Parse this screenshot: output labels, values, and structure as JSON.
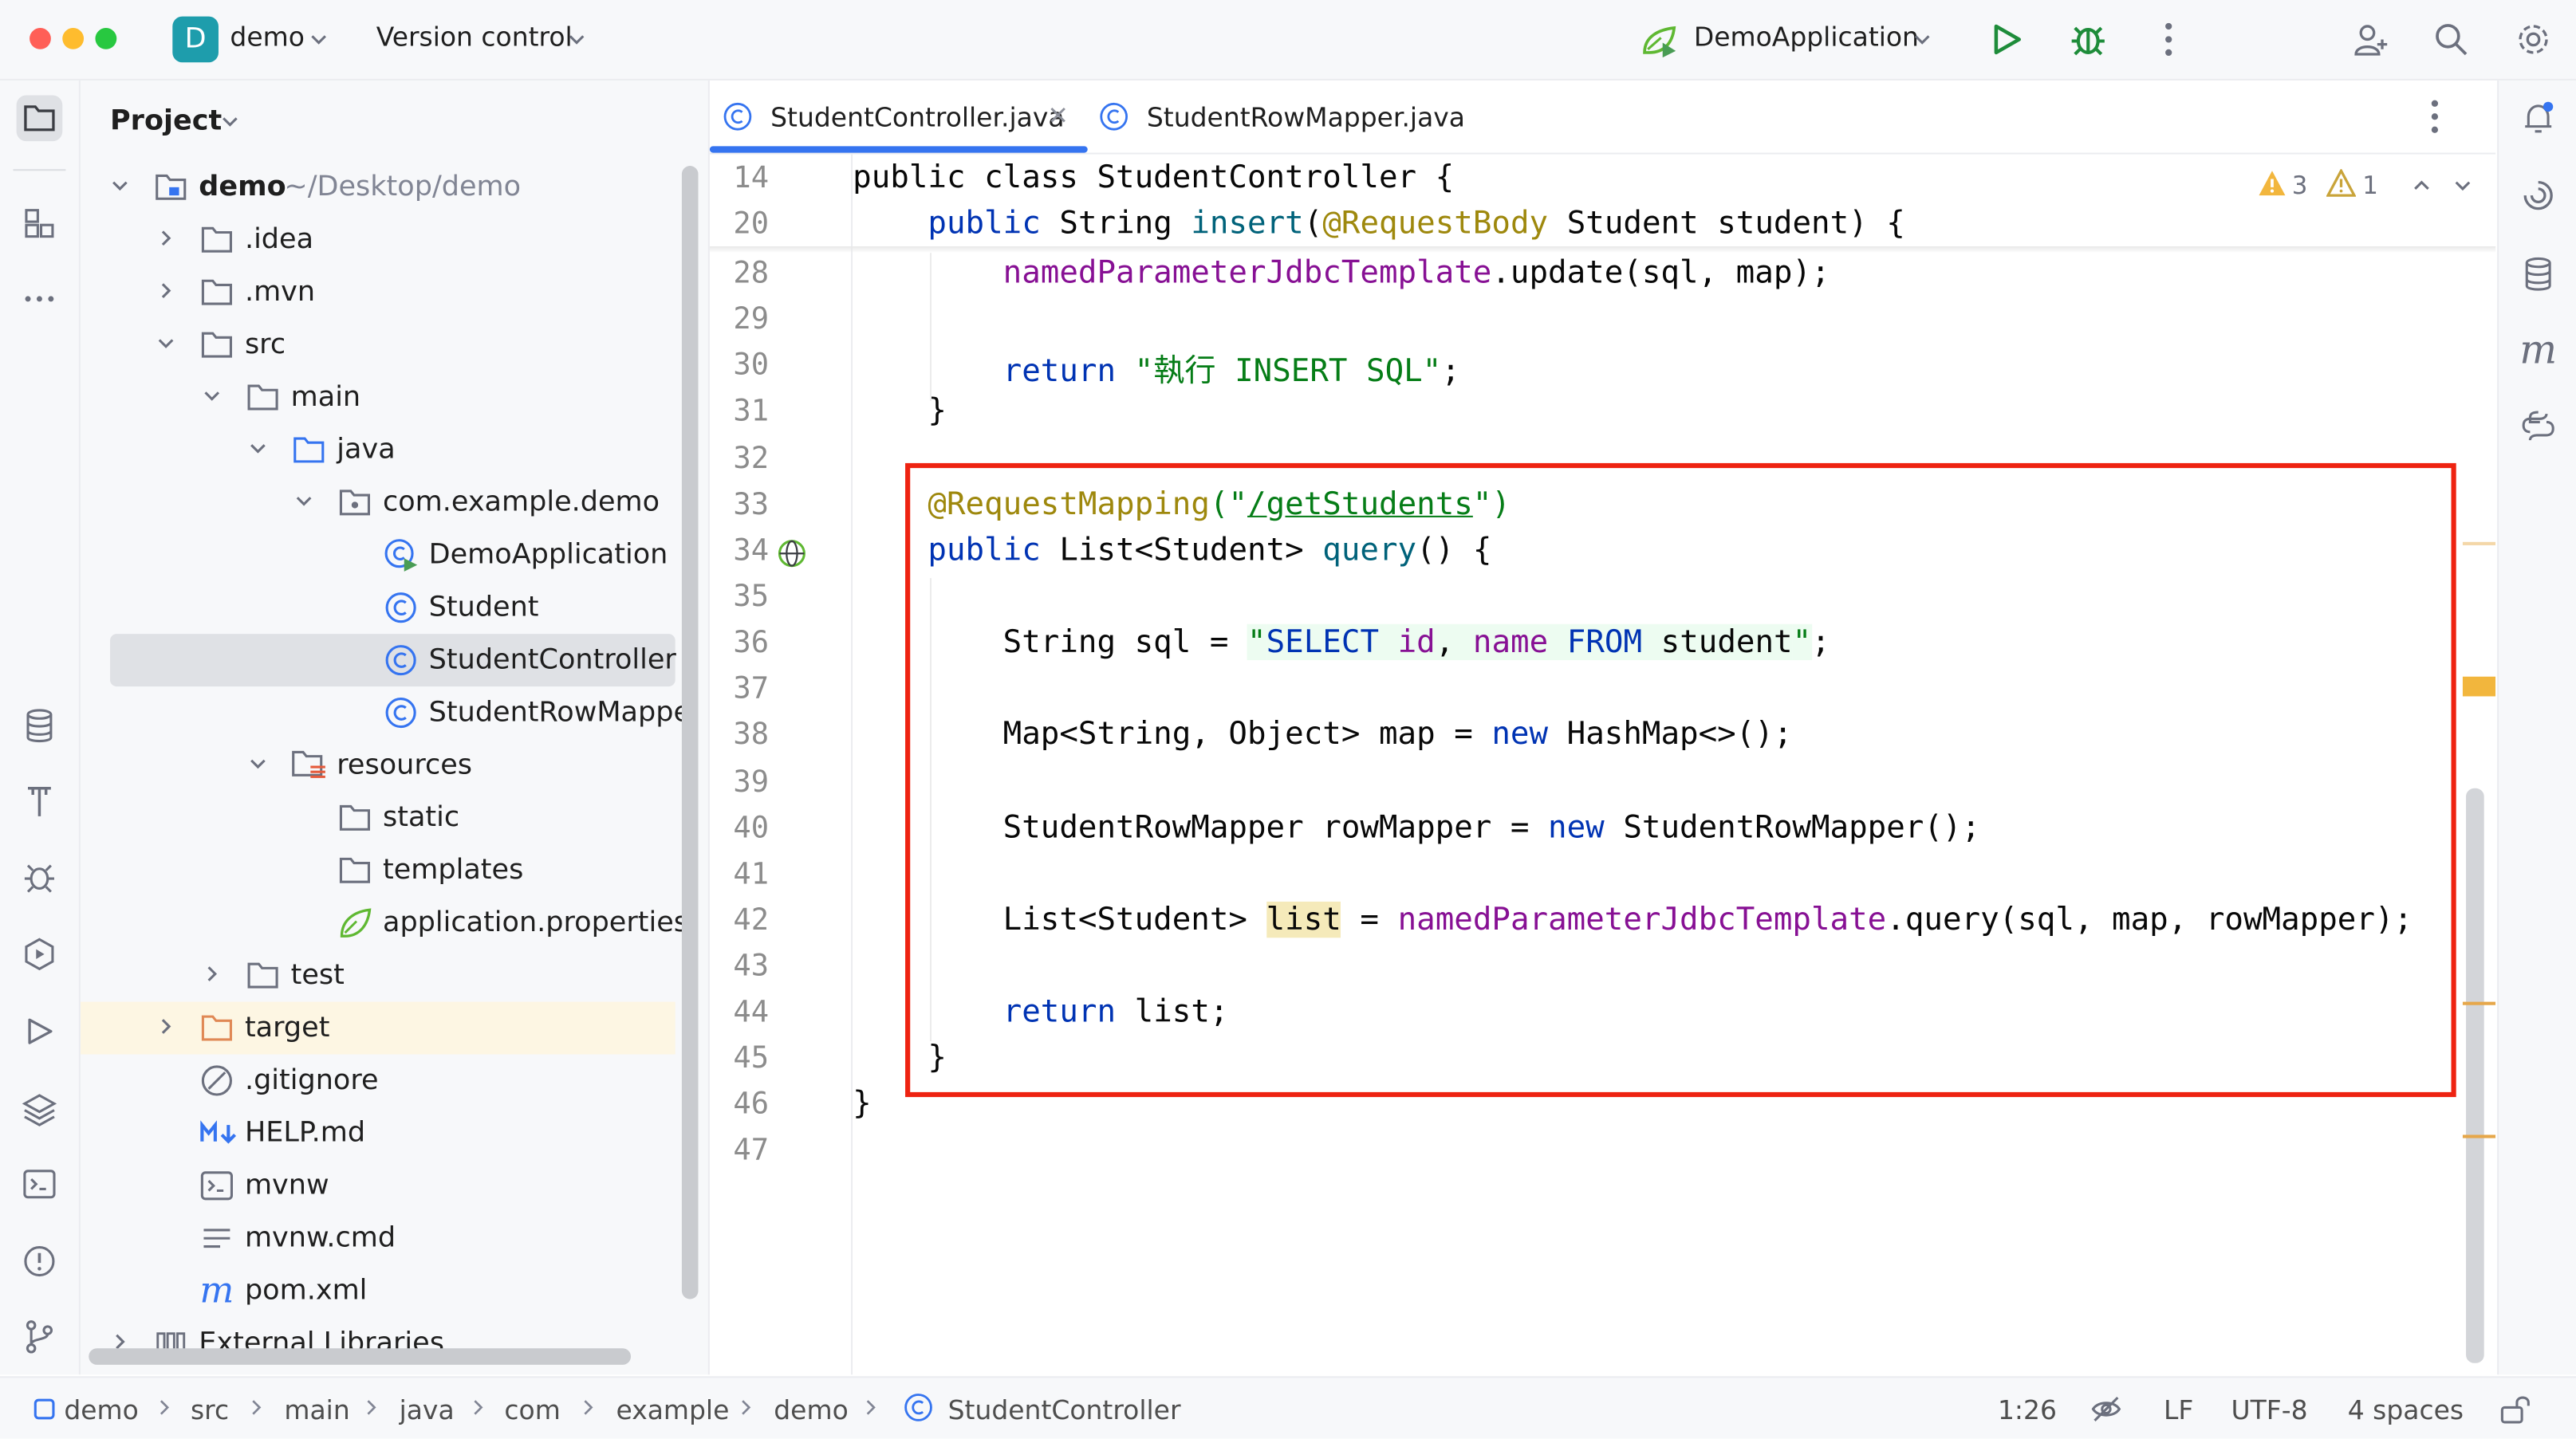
{
  "titlebar": {
    "project_letter": "D",
    "project_name": "demo",
    "version_control": "Version control",
    "run_config": "DemoApplication"
  },
  "project_panel": {
    "title": "Project",
    "tree": [
      {
        "label": "demo",
        "path_hint": "~/Desktop/demo",
        "icon": "module-folder-icon"
      },
      {
        "label": ".idea",
        "icon": "folder-icon"
      },
      {
        "label": ".mvn",
        "icon": "folder-icon"
      },
      {
        "label": "src",
        "icon": "folder-icon"
      },
      {
        "label": "main",
        "icon": "folder-icon"
      },
      {
        "label": "java",
        "icon": "source-folder-icon"
      },
      {
        "label": "com.example.demo",
        "icon": "package-icon"
      },
      {
        "label": "DemoApplication",
        "icon": "spring-class-icon"
      },
      {
        "label": "Student",
        "icon": "class-icon"
      },
      {
        "label": "StudentController",
        "icon": "class-icon"
      },
      {
        "label": "StudentRowMappe",
        "icon": "class-icon"
      },
      {
        "label": "resources",
        "icon": "resources-folder-icon"
      },
      {
        "label": "static",
        "icon": "folder-icon"
      },
      {
        "label": "templates",
        "icon": "folder-icon"
      },
      {
        "label": "application.properties",
        "icon": "spring-properties-icon"
      },
      {
        "label": "test",
        "icon": "folder-icon"
      },
      {
        "label": "target",
        "icon": "excluded-folder-icon"
      },
      {
        "label": ".gitignore",
        "icon": "ignore-file-icon"
      },
      {
        "label": "HELP.md",
        "icon": "markdown-icon"
      },
      {
        "label": "mvnw",
        "icon": "shell-icon"
      },
      {
        "label": "mvnw.cmd",
        "icon": "text-file-icon"
      },
      {
        "label": "pom.xml",
        "icon": "maven-icon"
      },
      {
        "label": "External Libraries",
        "icon": "library-icon"
      }
    ]
  },
  "editor": {
    "tabs": [
      {
        "label": "StudentController.java",
        "active": true
      },
      {
        "label": "StudentRowMapper.java",
        "active": false
      }
    ],
    "inspections": {
      "warnings": "3",
      "weak_warnings": "1"
    },
    "sticky_lines": [
      {
        "number": "14",
        "text": "public class StudentController {"
      },
      {
        "number": "20",
        "text": "    public String insert(@RequestBody Student student) {"
      }
    ],
    "lines": [
      {
        "number": "28"
      },
      {
        "number": "29"
      },
      {
        "number": "30"
      },
      {
        "number": "31"
      },
      {
        "number": "32"
      },
      {
        "number": "33"
      },
      {
        "number": "34"
      },
      {
        "number": "35"
      },
      {
        "number": "36"
      },
      {
        "number": "37"
      },
      {
        "number": "38"
      },
      {
        "number": "39"
      },
      {
        "number": "40"
      },
      {
        "number": "41"
      },
      {
        "number": "42"
      },
      {
        "number": "43"
      },
      {
        "number": "44"
      },
      {
        "number": "45"
      },
      {
        "number": "46"
      },
      {
        "number": "47"
      }
    ],
    "code": {
      "l28_field": "namedParameterJdbcTemplate",
      "l28_rest": ".update(sql, map);",
      "l30_kw": "return",
      "l30_str": "\"執行 INSERT SQL\"",
      "l30_end": ";",
      "l31": "}",
      "l33_ann": "@RequestMapping",
      "l33_open": "(\"",
      "l33_url": "/getStudents",
      "l33_close": "\")",
      "l34_kw": "public",
      "l34_type": " List<Student> ",
      "l34_method": "query",
      "l34_rest": "() {",
      "l36_decl": "String sql = ",
      "l36_q1": "\"",
      "l36_select": "SELECT",
      "l36_sp1": " ",
      "l36_id": "id",
      "l36_comma": ", ",
      "l36_name": "name",
      "l36_sp2": " ",
      "l36_from": "FROM",
      "l36_sp3": " ",
      "l36_table": "student",
      "l36_q2": "\"",
      "l36_end": ";",
      "l38_decl": "Map<String, Object> map = ",
      "l38_new": "new",
      "l38_rest": " HashMap<>();",
      "l40_decl": "StudentRowMapper rowMapper = ",
      "l40_new": "new",
      "l40_rest": " StudentRowMapper();",
      "l42_type": "List<Student> ",
      "l42_var": "list",
      "l42_eq": " = ",
      "l42_field": "namedParameterJdbcTemplate",
      "l42_rest": ".query(sql, map, rowMapper);",
      "l44_kw": "return",
      "l44_rest": " list;",
      "l45": "}",
      "l46": "}"
    }
  },
  "statusbar": {
    "breadcrumbs": [
      "demo",
      "src",
      "main",
      "java",
      "com",
      "example",
      "demo",
      "StudentController"
    ],
    "position": "1:26",
    "line_separator": "LF",
    "encoding": "UTF-8",
    "indent": "4 spaces"
  },
  "colors": {
    "keyword": "#0033b3",
    "annotation": "#9e880d",
    "string": "#067d17",
    "field": "#871094",
    "method": "#00627a",
    "highlight_box": "#ee2311",
    "tab_underline": "#3574f0"
  }
}
